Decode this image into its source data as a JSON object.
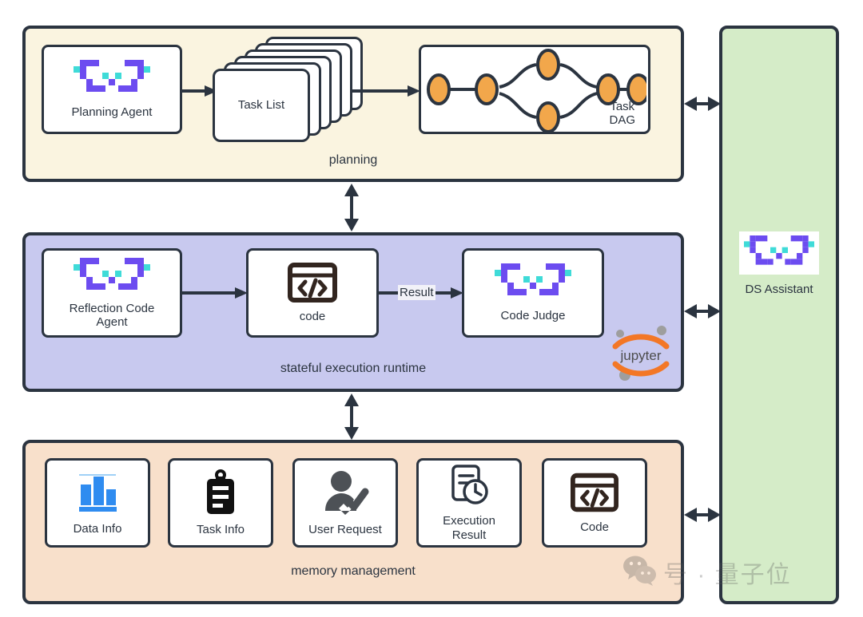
{
  "colors": {
    "planning_bg": "#faf4e0",
    "runtime_bg": "#c8c9ef",
    "memory_bg": "#f8e0cb",
    "assistant_bg": "#d5ecc8",
    "outline": "#2b3440",
    "dag_node": "#f2a74b",
    "logo_purple": "#6c4cf0",
    "logo_cyan": "#3fdbd8",
    "chart_blue": "#2f8cf0",
    "jupyter_orange": "#f37726"
  },
  "planning": {
    "label": "planning",
    "agent_card": {
      "label": "Planning Agent",
      "icon": "agent-pixel-icon"
    },
    "task_list": {
      "label": "Task List",
      "stack_count": 6
    },
    "task_dag": {
      "label": "Task\nDAG",
      "label_line1": "Task",
      "label_line2": "DAG",
      "node_count": 6
    }
  },
  "runtime": {
    "label": "stateful execution runtime",
    "reflection_card": {
      "label_line1": "Reflection Code",
      "label_line2": "Agent",
      "icon": "agent-pixel-icon"
    },
    "code_card": {
      "label": "code",
      "icon": "code-window-icon"
    },
    "result_edge_label": "Result",
    "judge_card": {
      "label": "Code Judge",
      "icon": "agent-pixel-icon"
    },
    "jupyter": {
      "label": "jupyter",
      "icon": "jupyter-logo-icon"
    }
  },
  "memory": {
    "label": "memory management",
    "cards": [
      {
        "label": "Data Info",
        "icon": "bar-chart-icon"
      },
      {
        "label": "Task Info",
        "icon": "clipboard-icon"
      },
      {
        "label": "User Request",
        "icon": "user-check-icon"
      },
      {
        "label_line1": "Execution",
        "label_line2": "Result",
        "icon": "document-clock-icon"
      },
      {
        "label": "Code",
        "icon": "code-window-icon"
      }
    ]
  },
  "assistant": {
    "label": "DS Assistant",
    "icon": "agent-pixel-icon"
  },
  "connectors": [
    {
      "name": "planning-to-runtime",
      "direction": "vertical-bidirectional"
    },
    {
      "name": "runtime-to-memory",
      "direction": "vertical-bidirectional"
    },
    {
      "name": "planning-to-assistant",
      "direction": "horizontal-bidirectional"
    },
    {
      "name": "runtime-to-assistant",
      "direction": "horizontal-bidirectional"
    },
    {
      "name": "memory-to-assistant",
      "direction": "horizontal-bidirectional"
    }
  ],
  "watermark": {
    "text": "号 · 量子位",
    "icon": "wechat-icon"
  }
}
